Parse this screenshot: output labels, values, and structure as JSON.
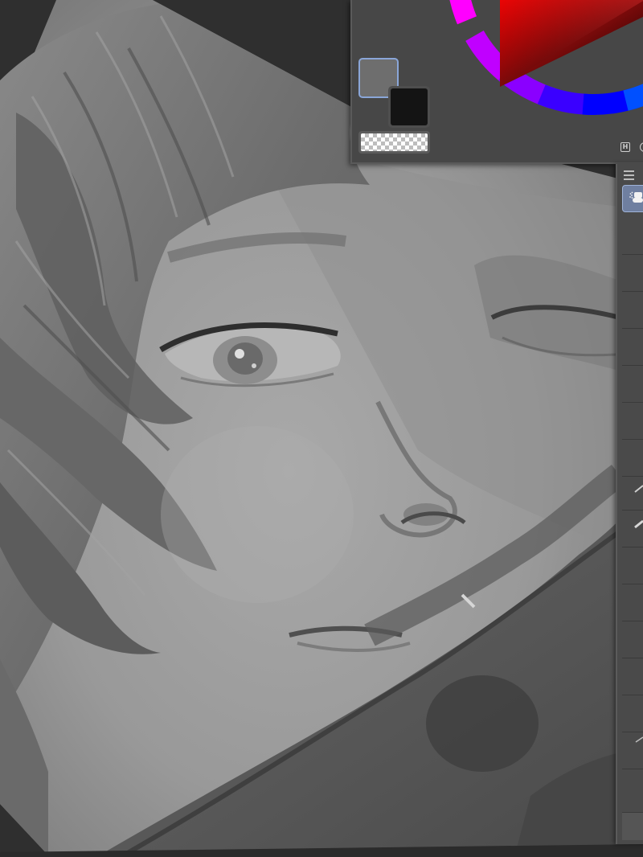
{
  "app": {
    "canvas": {
      "subject": ""
    },
    "color_panel": {
      "main_color": "#6e6e6e",
      "sub_color": "#141414",
      "transparent_color": "transparent",
      "accent_border": "#8aa6d8",
      "mode_icons": [
        "hsv-square-icon",
        "hsv-circle-icon"
      ]
    },
    "tool_palette": {
      "menu_icon": "hamburger-icon",
      "active_tool": "airbrush-icon",
      "accent": "#6f7fa0"
    }
  }
}
